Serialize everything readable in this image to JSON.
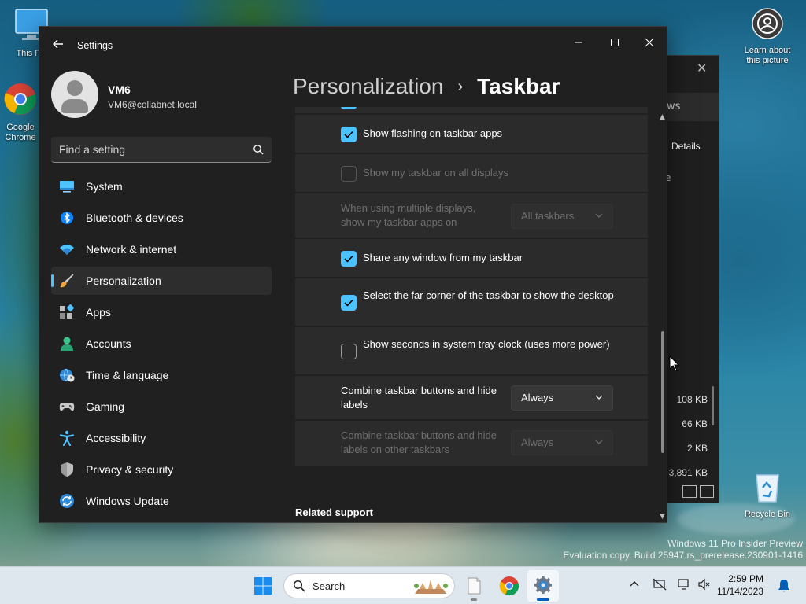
{
  "desktop": {
    "icons": [
      {
        "label": "This PC",
        "name": "this-pc"
      },
      {
        "label": "Google Chrome",
        "name": "google-chrome"
      },
      {
        "label": "Learn about this picture",
        "name": "learn-about-picture"
      },
      {
        "label": "Recycle Bin",
        "name": "recycle-bin"
      }
    ],
    "watermark": {
      "line1": "Windows 11 Pro Insider Preview",
      "line2": "Evaluation copy. Build 25947.rs_prerelease.230901-1416"
    }
  },
  "background_window": {
    "tab_text": "ws",
    "details_label": "Details",
    "col_fragment": "e",
    "sizes": [
      "108 KB",
      "66 KB",
      "2 KB",
      "3,891 KB"
    ]
  },
  "settings": {
    "title": "Settings",
    "user": {
      "name": "VM6",
      "email": "VM6@collabnet.local"
    },
    "search": {
      "placeholder": "Find a setting"
    },
    "nav": [
      {
        "label": "System",
        "icon": "system-icon",
        "active": false
      },
      {
        "label": "Bluetooth & devices",
        "icon": "bluetooth-icon",
        "active": false
      },
      {
        "label": "Network & internet",
        "icon": "wifi-icon",
        "active": false
      },
      {
        "label": "Personalization",
        "icon": "brush-icon",
        "active": true
      },
      {
        "label": "Apps",
        "icon": "apps-icon",
        "active": false
      },
      {
        "label": "Accounts",
        "icon": "accounts-icon",
        "active": false
      },
      {
        "label": "Time & language",
        "icon": "globe-icon",
        "active": false
      },
      {
        "label": "Gaming",
        "icon": "gamepad-icon",
        "active": false
      },
      {
        "label": "Accessibility",
        "icon": "accessibility-icon",
        "active": false
      },
      {
        "label": "Privacy & security",
        "icon": "shield-icon",
        "active": false
      },
      {
        "label": "Windows Update",
        "icon": "update-icon",
        "active": false
      }
    ],
    "breadcrumb": {
      "parent": "Personalization",
      "separator": "›",
      "current": "Taskbar"
    },
    "options": {
      "flashing": {
        "label": "Show flashing on taskbar apps",
        "checked": true
      },
      "all_displays": {
        "label": "Show my taskbar on all displays",
        "checked": false,
        "disabled": true
      },
      "multi_display": {
        "label": "When using multiple displays, show my taskbar apps on",
        "value": "All taskbars",
        "disabled": true
      },
      "share_window": {
        "label": "Share any window from my taskbar",
        "checked": true
      },
      "far_corner": {
        "label": "Select the far corner of the taskbar to show the desktop",
        "checked": true
      },
      "seconds": {
        "label": "Show seconds in system tray clock (uses more power)",
        "checked": false
      },
      "combine": {
        "label": "Combine taskbar buttons and hide labels",
        "value": "Always"
      },
      "combine_other": {
        "label": "Combine taskbar buttons and hide labels on other taskbars",
        "value": "Always",
        "disabled": true
      }
    },
    "related_support": "Related support"
  },
  "taskbar": {
    "search_label": "Search",
    "clock": {
      "time": "2:59 PM",
      "date": "11/14/2023"
    }
  },
  "colors": {
    "accent": "#4cc2ff",
    "window_bg": "#202020",
    "card_bg": "#2b2b2b"
  }
}
